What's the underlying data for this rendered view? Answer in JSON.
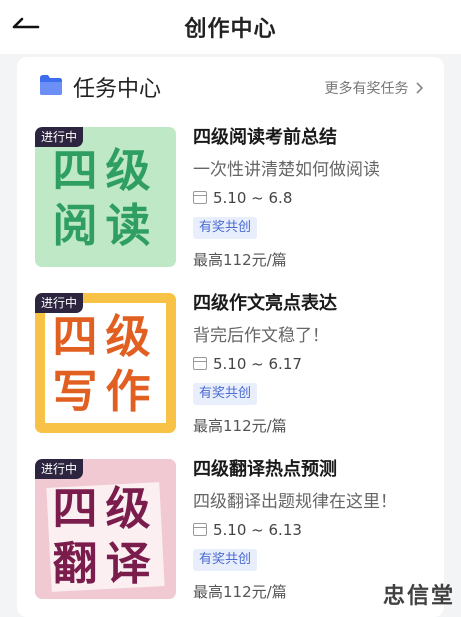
{
  "header": {
    "title": "创作中心",
    "back_icon": "back-arrow-icon"
  },
  "section": {
    "title": "任务中心",
    "more_label": "更多有奖任务",
    "folder_icon": "folder-icon",
    "chevron_icon": "chevron-right-icon"
  },
  "tasks": [
    {
      "tag": "进行中",
      "cover_line1": "四级",
      "cover_line2": "阅读",
      "title": "四级阅读考前总结",
      "subtitle": "一次性讲清楚如何做阅读",
      "date": "5.10 ~ 6.8",
      "badge": "有奖共创",
      "price": "最高112元/篇",
      "cover_bg": "#bfe8c6",
      "cover_text_color": "#2f9e61"
    },
    {
      "tag": "进行中",
      "cover_line1": "四级",
      "cover_line2": "写作",
      "title": "四级作文亮点表达",
      "subtitle": "背完后作文稳了！",
      "date": "5.10 ~ 6.17",
      "badge": "有奖共创",
      "price": "最高112元/篇",
      "cover_bg": "#f7c245",
      "cover_text_color": "#e25f22"
    },
    {
      "tag": "进行中",
      "cover_line1": "四级",
      "cover_line2": "翻译",
      "title": "四级翻译热点预测",
      "subtitle": "四级翻译出题规律在这里！",
      "date": "5.10 ~ 6.13",
      "badge": "有奖共创",
      "price": "最高112元/篇",
      "cover_bg": "#f0c9d3",
      "cover_text_color": "#7b1d4c"
    }
  ],
  "watermark": "忠信堂"
}
